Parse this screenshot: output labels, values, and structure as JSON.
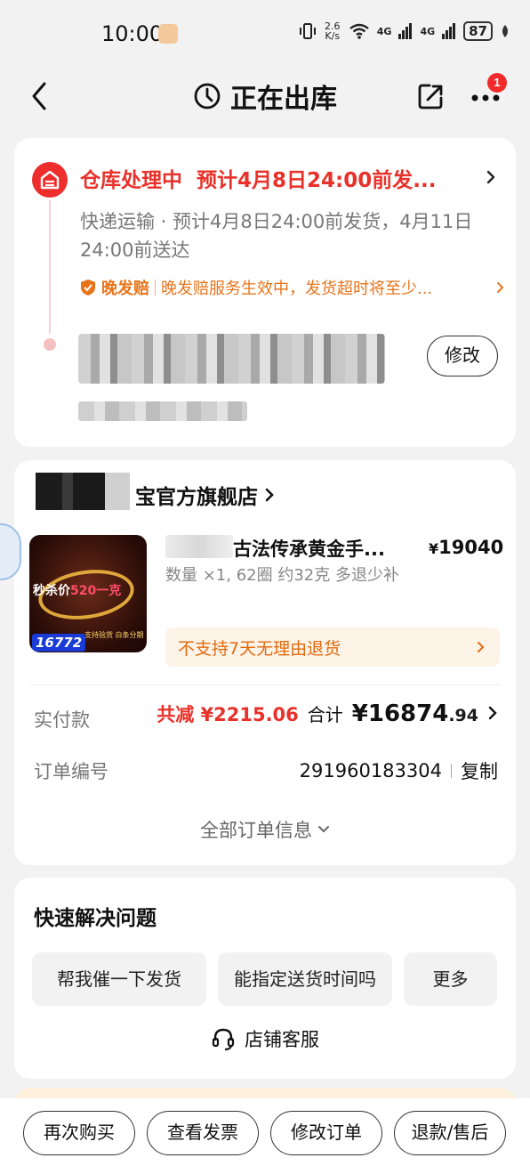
{
  "status_bar": {
    "time": "10:00",
    "net_speed_top": "2.6",
    "net_speed_bottom": "K/s",
    "signal1": "4G",
    "signal2": "4G",
    "battery": "87"
  },
  "header": {
    "title": "正在出库",
    "notification_count": "1"
  },
  "shipping": {
    "status": "仓库处理中",
    "estimate": "预计4月8日24:00前发...",
    "description": "快递运输 · 预计4月8日24:00前发货，4月11日24:00前送达",
    "guarantee_tag": "晚发赔",
    "guarantee_text": "晚发赔服务生效中，发货超时将至少...",
    "edit_label": "修改"
  },
  "order": {
    "shop_name": "宝官方旗舰店",
    "product": {
      "title": "古法传承黄金手...",
      "price_symbol": "¥",
      "price": "19040",
      "spec": "数量 ×1, 62圈 约32克 多退少补",
      "image_promo_prefix": "秒杀价",
      "image_promo_highlight": "520一克",
      "image_price": "16772",
      "image_sub": "支持验货 白条分期"
    },
    "no_return": "不支持7天无理由退货",
    "paid_label": "实付款",
    "discount": "共减 ¥2215.06",
    "total_label": "合计",
    "total_amount": "¥16874",
    "total_decimal": ".94",
    "order_no_label": "订单编号",
    "order_no": "291960183304",
    "copy_label": "复制",
    "all_info": "全部订单信息"
  },
  "quick_solve": {
    "title": "快速解决问题",
    "chips": [
      "帮我催一下发货",
      "能指定送货时间吗",
      "更多"
    ],
    "customer_service": "店铺客服"
  },
  "bottom_actions": [
    "再次购买",
    "查看发票",
    "修改订单",
    "退款/售后"
  ],
  "colors": {
    "accent_red": "#e8312a",
    "accent_orange": "#e8741a",
    "background": "#f2f2f2"
  }
}
